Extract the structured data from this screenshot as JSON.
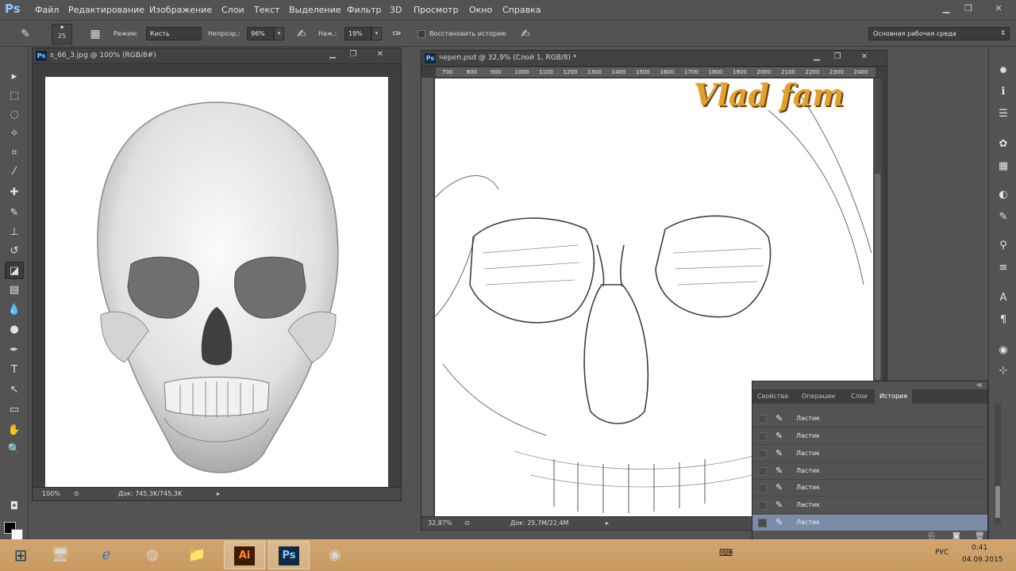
{
  "app": {
    "logo": "Ps"
  },
  "menu": [
    "Файл",
    "Редактирование",
    "Изображение",
    "Слои",
    "Текст",
    "Выделение",
    "Фильтр",
    "3D",
    "Просмотр",
    "Окно",
    "Справка"
  ],
  "window_controls": {
    "minimize": "▁",
    "restore": "❐",
    "close": "✕"
  },
  "options": {
    "brush_size": "25",
    "mode_label": "Режим:",
    "mode_value": "Кисть",
    "opacity_label": "Непрозр.:",
    "opacity_value": "96%",
    "pressure_label": "Наж.:",
    "pressure_value": "19%",
    "history_checkbox": "Восстановить историю",
    "workspace": "Основная рабочая среда"
  },
  "doc_left": {
    "title": "s_66_3.jpg @ 100% (RGB/8#)",
    "zoom": "100%",
    "info": "Док: 745,3K/745,3K"
  },
  "doc_right": {
    "title": "череп.psd @ 32,9% (Слой 1, RGB/8) *",
    "zoom": "32,87%",
    "info": "Док: 25,7M/22,4M",
    "ruler_ticks": [
      "700",
      "800",
      "900",
      "1000",
      "1100",
      "1200",
      "1300",
      "1400",
      "1500",
      "1600",
      "1700",
      "1800",
      "1900",
      "2000",
      "2100",
      "2200",
      "2300",
      "2400"
    ],
    "watermark": "Vlad fam"
  },
  "history": {
    "tabs": [
      "Свойства",
      "Операции",
      "Слои",
      "История"
    ],
    "active_tab": "История",
    "items": [
      "Ластик",
      "Ластик",
      "Ластик",
      "Ластик",
      "Ластик",
      "Ластик",
      "Ластик"
    ]
  },
  "taskbar": {
    "lang": "РУС",
    "time": "0:41",
    "date": "04.09.2015",
    "apps": [
      "windows-start",
      "explorer-app",
      "ie-app",
      "chrome-app",
      "folder-app",
      "illustrator-app",
      "photoshop-app",
      "obs-app"
    ],
    "ai_label": "Ai",
    "ps_label": "Ps"
  }
}
